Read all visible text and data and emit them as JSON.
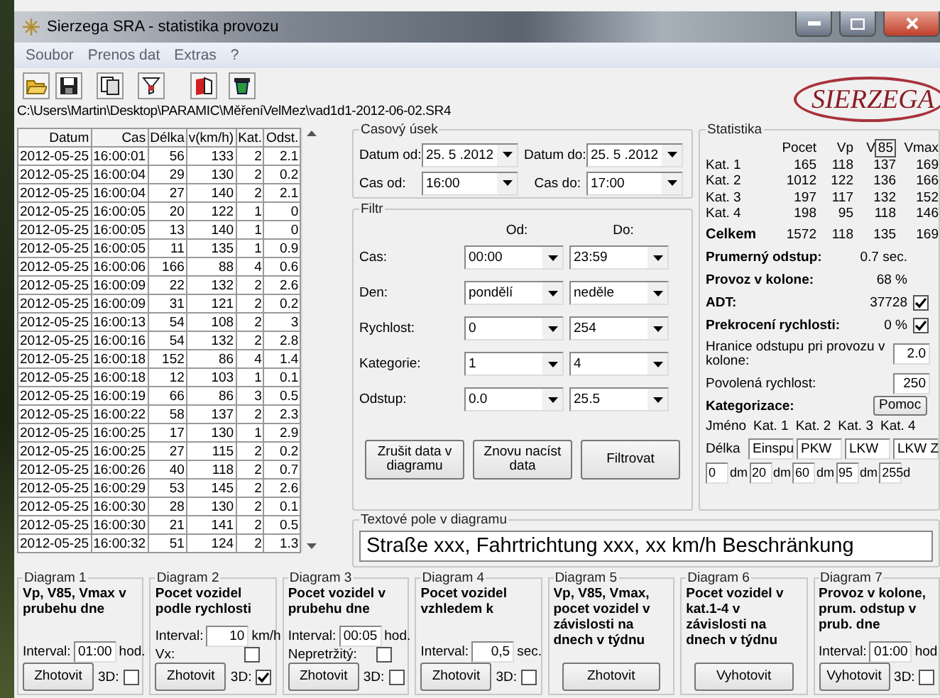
{
  "window": {
    "title": "Sierzega SRA - statistika provozu"
  },
  "menu": [
    "Soubor",
    "Prenos dat",
    "Extras",
    "?"
  ],
  "file_path": "C:\\Users\\Martin\\Desktop\\PARAMIC\\MěřeníVelMez\\vad1d1-2012-06-02.SR4",
  "logo": "SIERZEGA",
  "table": {
    "columns": [
      "Datum",
      "Cas",
      "Délka",
      "v(km/h)",
      "Kat.",
      "Odst."
    ],
    "rows": [
      [
        "2012-05-25",
        "16:00:01",
        "56",
        "133",
        "2",
        "2.1"
      ],
      [
        "2012-05-25",
        "16:00:04",
        "29",
        "130",
        "2",
        "0.2"
      ],
      [
        "2012-05-25",
        "16:00:04",
        "27",
        "140",
        "2",
        "2.1"
      ],
      [
        "2012-05-25",
        "16:00:05",
        "20",
        "122",
        "1",
        "0"
      ],
      [
        "2012-05-25",
        "16:00:05",
        "13",
        "140",
        "1",
        "0"
      ],
      [
        "2012-05-25",
        "16:00:05",
        "11",
        "135",
        "1",
        "0.9"
      ],
      [
        "2012-05-25",
        "16:00:06",
        "166",
        "88",
        "4",
        "0.6"
      ],
      [
        "2012-05-25",
        "16:00:09",
        "22",
        "132",
        "2",
        "2.6"
      ],
      [
        "2012-05-25",
        "16:00:09",
        "31",
        "121",
        "2",
        "0.2"
      ],
      [
        "2012-05-25",
        "16:00:13",
        "54",
        "108",
        "2",
        "3"
      ],
      [
        "2012-05-25",
        "16:00:16",
        "54",
        "132",
        "2",
        "2.8"
      ],
      [
        "2012-05-25",
        "16:00:18",
        "152",
        "86",
        "4",
        "1.4"
      ],
      [
        "2012-05-25",
        "16:00:18",
        "12",
        "103",
        "1",
        "0.1"
      ],
      [
        "2012-05-25",
        "16:00:19",
        "66",
        "86",
        "3",
        "0.5"
      ],
      [
        "2012-05-25",
        "16:00:22",
        "58",
        "137",
        "2",
        "2.3"
      ],
      [
        "2012-05-25",
        "16:00:25",
        "17",
        "130",
        "1",
        "2.9"
      ],
      [
        "2012-05-25",
        "16:00:25",
        "27",
        "115",
        "2",
        "0.2"
      ],
      [
        "2012-05-25",
        "16:00:26",
        "40",
        "118",
        "2",
        "0.7"
      ],
      [
        "2012-05-25",
        "16:00:29",
        "53",
        "145",
        "2",
        "2.6"
      ],
      [
        "2012-05-25",
        "16:00:30",
        "28",
        "130",
        "2",
        "0.1"
      ],
      [
        "2012-05-25",
        "16:00:30",
        "21",
        "141",
        "2",
        "0.5"
      ],
      [
        "2012-05-25",
        "16:00:32",
        "51",
        "124",
        "2",
        "1.3"
      ]
    ]
  },
  "time_range": {
    "title": "Casový úsek",
    "fields": [
      {
        "label": "Datum od:",
        "value": "25. 5 .2012"
      },
      {
        "label": "Datum do:",
        "value": "25. 5 .2012"
      },
      {
        "label": "Cas od:",
        "value": "16:00"
      },
      {
        "label": "Cas do:",
        "value": "17:00"
      }
    ]
  },
  "filter": {
    "title": "Filtr",
    "from_label": "Od:",
    "to_label": "Do:",
    "rows": [
      {
        "label": "Cas:",
        "from": "00:00",
        "to": "23:59"
      },
      {
        "label": "Den:",
        "from": "pondělí",
        "to": "neděle"
      },
      {
        "label": "Rychlost:",
        "from": "0",
        "to": "254"
      },
      {
        "label": "Kategorie:",
        "from": "1",
        "to": "4"
      },
      {
        "label": "Odstup:",
        "from": "0.0",
        "to": "25.5"
      }
    ],
    "buttons": [
      "Zrušit data v diagramu",
      "Znovu nacíst data",
      "Filtrovat"
    ]
  },
  "statistics": {
    "title": "Statistika",
    "columns": [
      {
        "label": "Pocet"
      },
      {
        "label": "Vp"
      },
      {
        "label": "V",
        "boxed": "85"
      },
      {
        "label": "Vmax"
      }
    ],
    "rows": [
      {
        "label": "Kat. 1",
        "values": [
          "165",
          "118",
          "137",
          "169"
        ],
        "total": false
      },
      {
        "label": "Kat. 2",
        "values": [
          "1012",
          "122",
          "136",
          "166"
        ],
        "total": false
      },
      {
        "label": "Kat. 3",
        "values": [
          "197",
          "117",
          "132",
          "152"
        ],
        "total": false
      },
      {
        "label": "Kat. 4",
        "values": [
          "198",
          "95",
          "118",
          "146"
        ],
        "total": false
      },
      {
        "label": "Celkem",
        "values": [
          "1572",
          "118",
          "135",
          "169"
        ],
        "total": true
      }
    ],
    "summary": [
      {
        "kind": "value",
        "label": "Prumerný odstup:",
        "value": "0.7 sec."
      },
      {
        "kind": "value",
        "label": "Provoz v kolone:",
        "value": "68 %"
      },
      {
        "kind": "check",
        "label": "ADT:",
        "value": "37728",
        "checked": true
      },
      {
        "kind": "check",
        "label": "Prekrocení rychlosti:",
        "value": "0 %",
        "checked": true
      }
    ],
    "inputs": [
      {
        "label": "Hranice odstupu pri provozu v kolone:",
        "value": "2.0"
      },
      {
        "label": "Povolená rychlost:",
        "value": "250"
      }
    ],
    "categorization": {
      "title": "Kategorizace:",
      "help": "Pomoc",
      "name_label": "Jméno",
      "categories": [
        "Kat. 1",
        "Kat. 2",
        "Kat. 3",
        "Kat. 4"
      ],
      "length_label": "Délka",
      "names": [
        "Einspu",
        "PKW",
        "LKW",
        "LKW Z"
      ],
      "limits": [
        {
          "value": "0",
          "unit": "dm"
        },
        {
          "value": "20",
          "unit": "dm"
        },
        {
          "value": "60",
          "unit": "dm"
        },
        {
          "value": "95",
          "unit": "dm"
        },
        {
          "value": "255",
          "unit": "d"
        }
      ]
    }
  },
  "diagram_text": {
    "title": "Textové pole v diagramu",
    "value": "Straße xxx, Fahrtrichtung xxx, xx km/h Beschränkung"
  },
  "diagrams": [
    {
      "title": "Diagram 1",
      "description": "Vp, V85, Vmax v prubehu dne",
      "options": [
        {
          "kind": "interval",
          "label": "Interval:",
          "value": "01:00",
          "unit": "hod."
        }
      ],
      "button": "Zhotovit",
      "three_d": {
        "label": "3D:",
        "checked": false
      }
    },
    {
      "title": "Diagram 2",
      "description": "Pocet vozidel podle rychlosti",
      "options": [
        {
          "kind": "interval",
          "label": "Interval:",
          "value": "10",
          "unit": "km/h"
        },
        {
          "kind": "check",
          "label": "Vx:",
          "checked": false
        }
      ],
      "button": "Zhotovit",
      "three_d": {
        "label": "3D:",
        "checked": true
      }
    },
    {
      "title": "Diagram 3",
      "description": "Pocet vozidel v prubehu dne",
      "options": [
        {
          "kind": "interval",
          "label": "Interval:",
          "value": "00:05",
          "unit": "hod."
        },
        {
          "kind": "check",
          "label": "Nepretržitý:",
          "checked": false
        }
      ],
      "button": "Zhotovit",
      "three_d": {
        "label": "3D:",
        "checked": false
      }
    },
    {
      "title": "Diagram 4",
      "description": "Pocet vozidel vzhledem k",
      "options": [
        {
          "kind": "interval",
          "label": "Interval:",
          "value": "0,5",
          "unit": "sec."
        }
      ],
      "button": "Zhotovit",
      "three_d": {
        "label": "3D:",
        "checked": false
      }
    },
    {
      "title": "Diagram 5",
      "description": "Vp, V85, Vmax, pocet vozidel v závislosti na dnech v týdnu",
      "button": "Zhotovit"
    },
    {
      "title": "Diagram 6",
      "description": "Pocet vozidel v kat.1-4 v závislosti na dnech v týdnu",
      "button": "Vyhotovit"
    },
    {
      "title": "Diagram 7",
      "description": "Provoz v kolone, prum. odstup v prub. dne",
      "options": [
        {
          "kind": "interval",
          "label": "Interval:",
          "value": "01:00",
          "unit": "hod"
        }
      ],
      "button": "Vyhotovit",
      "three_d": {
        "label": "3D:",
        "checked": false
      }
    }
  ]
}
